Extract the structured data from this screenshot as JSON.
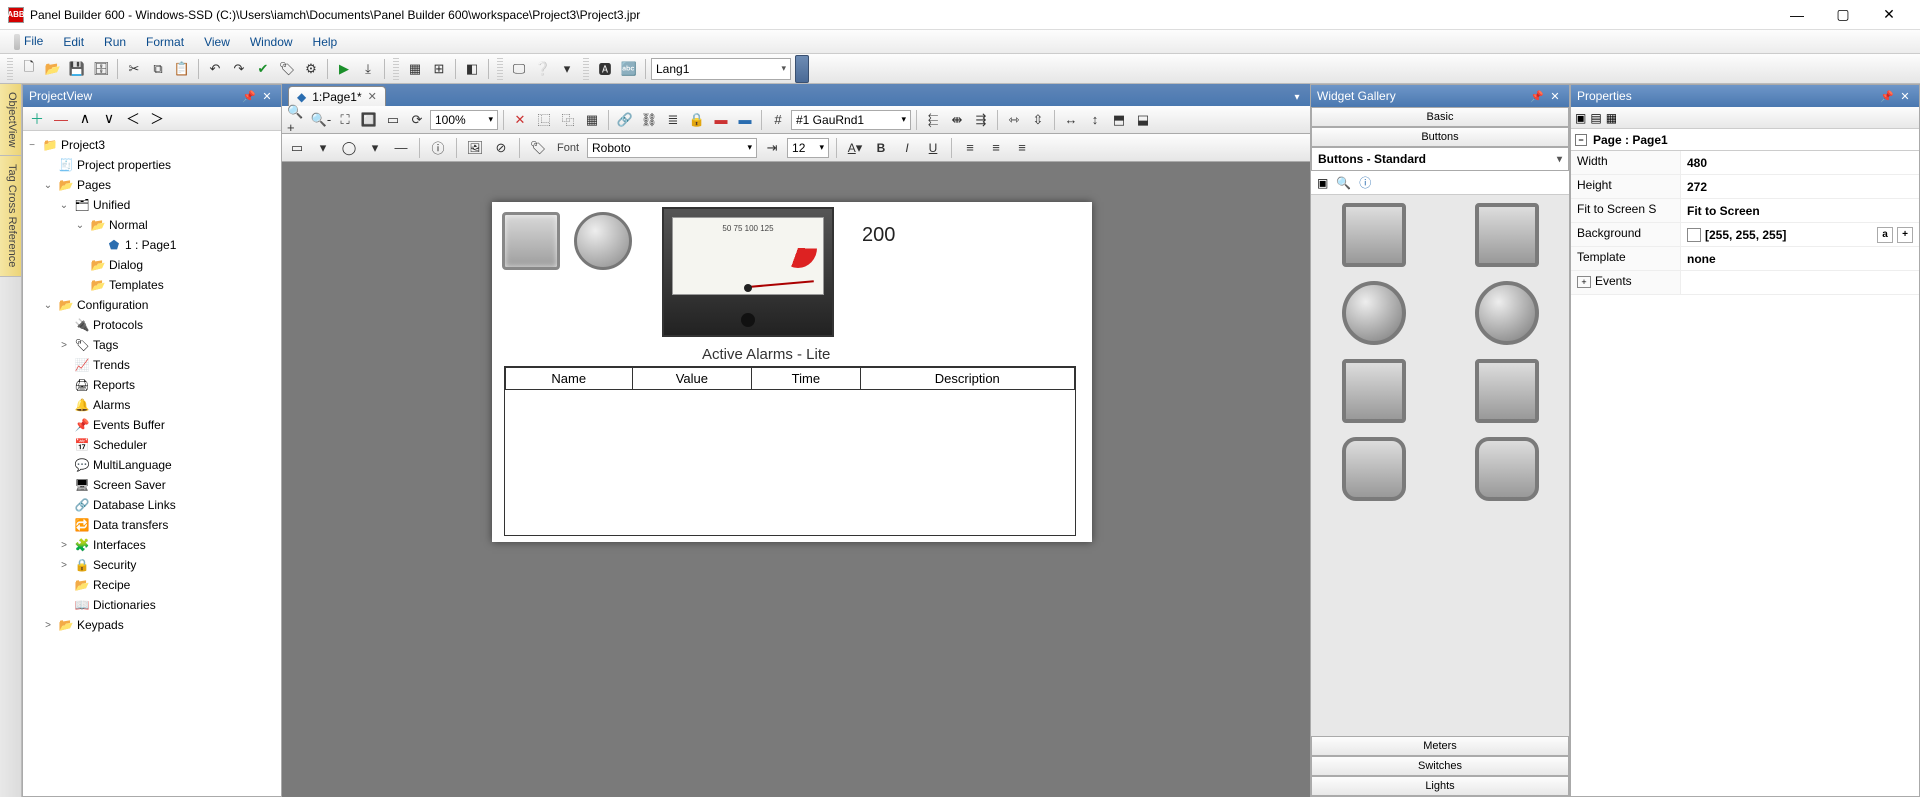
{
  "titlebar": {
    "app_icon_text": "ABB",
    "title": "Panel Builder 600 - Windows-SSD (C:)\\Users\\iamch\\Documents\\Panel Builder 600\\workspace\\Project3\\Project3.jpr"
  },
  "menu": {
    "items": [
      "File",
      "Edit",
      "Run",
      "Format",
      "View",
      "Window",
      "Help"
    ]
  },
  "toolbar": {
    "lang_label": "Lang1"
  },
  "sidetabs": {
    "object": "ObjectView",
    "tagxref": "Tag Cross Reference"
  },
  "projectview": {
    "title": "ProjectView",
    "tree": [
      {
        "lvl": 0,
        "toggle": "−",
        "icon": "📁",
        "label": "Project3",
        "cls": ""
      },
      {
        "lvl": 1,
        "toggle": "",
        "icon": "🧾",
        "label": "Project properties",
        "cls": ""
      },
      {
        "lvl": 1,
        "toggle": "⌄",
        "icon": "📂",
        "label": "Pages",
        "cls": "folder-icon"
      },
      {
        "lvl": 2,
        "toggle": "⌄",
        "icon": "🗂",
        "label": "Unified",
        "cls": ""
      },
      {
        "lvl": 3,
        "toggle": "⌄",
        "icon": "📂",
        "label": "Normal",
        "cls": "folder-icon"
      },
      {
        "lvl": 4,
        "toggle": "",
        "icon": "⬟",
        "label": "1 : Page1",
        "cls": "page-icon"
      },
      {
        "lvl": 3,
        "toggle": "",
        "icon": "📂",
        "label": "Dialog",
        "cls": "folder-icon"
      },
      {
        "lvl": 3,
        "toggle": "",
        "icon": "📂",
        "label": "Templates",
        "cls": "folder-icon"
      },
      {
        "lvl": 1,
        "toggle": "⌄",
        "icon": "📂",
        "label": "Configuration",
        "cls": "folder-icon"
      },
      {
        "lvl": 2,
        "toggle": "",
        "icon": "🔌",
        "label": "Protocols",
        "cls": ""
      },
      {
        "lvl": 2,
        "toggle": ">",
        "icon": "🏷",
        "label": "Tags",
        "cls": ""
      },
      {
        "lvl": 2,
        "toggle": "",
        "icon": "📈",
        "label": "Trends",
        "cls": ""
      },
      {
        "lvl": 2,
        "toggle": "",
        "icon": "🖨",
        "label": "Reports",
        "cls": ""
      },
      {
        "lvl": 2,
        "toggle": "",
        "icon": "🔔",
        "label": "Alarms",
        "cls": ""
      },
      {
        "lvl": 2,
        "toggle": "",
        "icon": "📌",
        "label": "Events Buffer",
        "cls": ""
      },
      {
        "lvl": 2,
        "toggle": "",
        "icon": "📅",
        "label": "Scheduler",
        "cls": ""
      },
      {
        "lvl": 2,
        "toggle": "",
        "icon": "💬",
        "label": "MultiLanguage",
        "cls": ""
      },
      {
        "lvl": 2,
        "toggle": "",
        "icon": "🖥",
        "label": "Screen Saver",
        "cls": ""
      },
      {
        "lvl": 2,
        "toggle": "",
        "icon": "🔗",
        "label": "Database Links",
        "cls": ""
      },
      {
        "lvl": 2,
        "toggle": "",
        "icon": "🔁",
        "label": "Data transfers",
        "cls": ""
      },
      {
        "lvl": 2,
        "toggle": ">",
        "icon": "🧩",
        "label": "Interfaces",
        "cls": ""
      },
      {
        "lvl": 2,
        "toggle": ">",
        "icon": "🔒",
        "label": "Security",
        "cls": ""
      },
      {
        "lvl": 2,
        "toggle": "",
        "icon": "📂",
        "label": "Recipe",
        "cls": "folder-icon"
      },
      {
        "lvl": 2,
        "toggle": "",
        "icon": "📖",
        "label": "Dictionaries",
        "cls": ""
      },
      {
        "lvl": 1,
        "toggle": ">",
        "icon": "📂",
        "label": "Keypads",
        "cls": "folder-icon"
      }
    ]
  },
  "doc": {
    "tab_label": "1:Page1*"
  },
  "canvas_tb": {
    "zoom": "100%",
    "gau": "#1 GauRnd1",
    "font_label": "Font",
    "font": "Roboto",
    "size": "12"
  },
  "canvas": {
    "value_text": "200",
    "table_title": "Active Alarms - Lite",
    "gauge_ticks": "50   75   100   125",
    "cols": [
      "Name",
      "Value",
      "Time",
      "Description"
    ]
  },
  "gallery": {
    "title": "Widget Gallery",
    "tabs": {
      "basic": "Basic",
      "buttons": "Buttons"
    },
    "category": "Buttons - Standard",
    "bottom": {
      "meters": "Meters",
      "switches": "Switches",
      "lights": "Lights"
    }
  },
  "props": {
    "title": "Properties",
    "page_label": "Page : Page1",
    "rows": [
      {
        "k": "Width",
        "v": "480"
      },
      {
        "k": "Height",
        "v": "272"
      },
      {
        "k": "Fit to Screen S",
        "v": "Fit to Screen"
      },
      {
        "k": "Background",
        "v": "[255, 255, 255]",
        "color": true
      },
      {
        "k": "Template",
        "v": "none"
      }
    ],
    "events_label": "Events"
  }
}
